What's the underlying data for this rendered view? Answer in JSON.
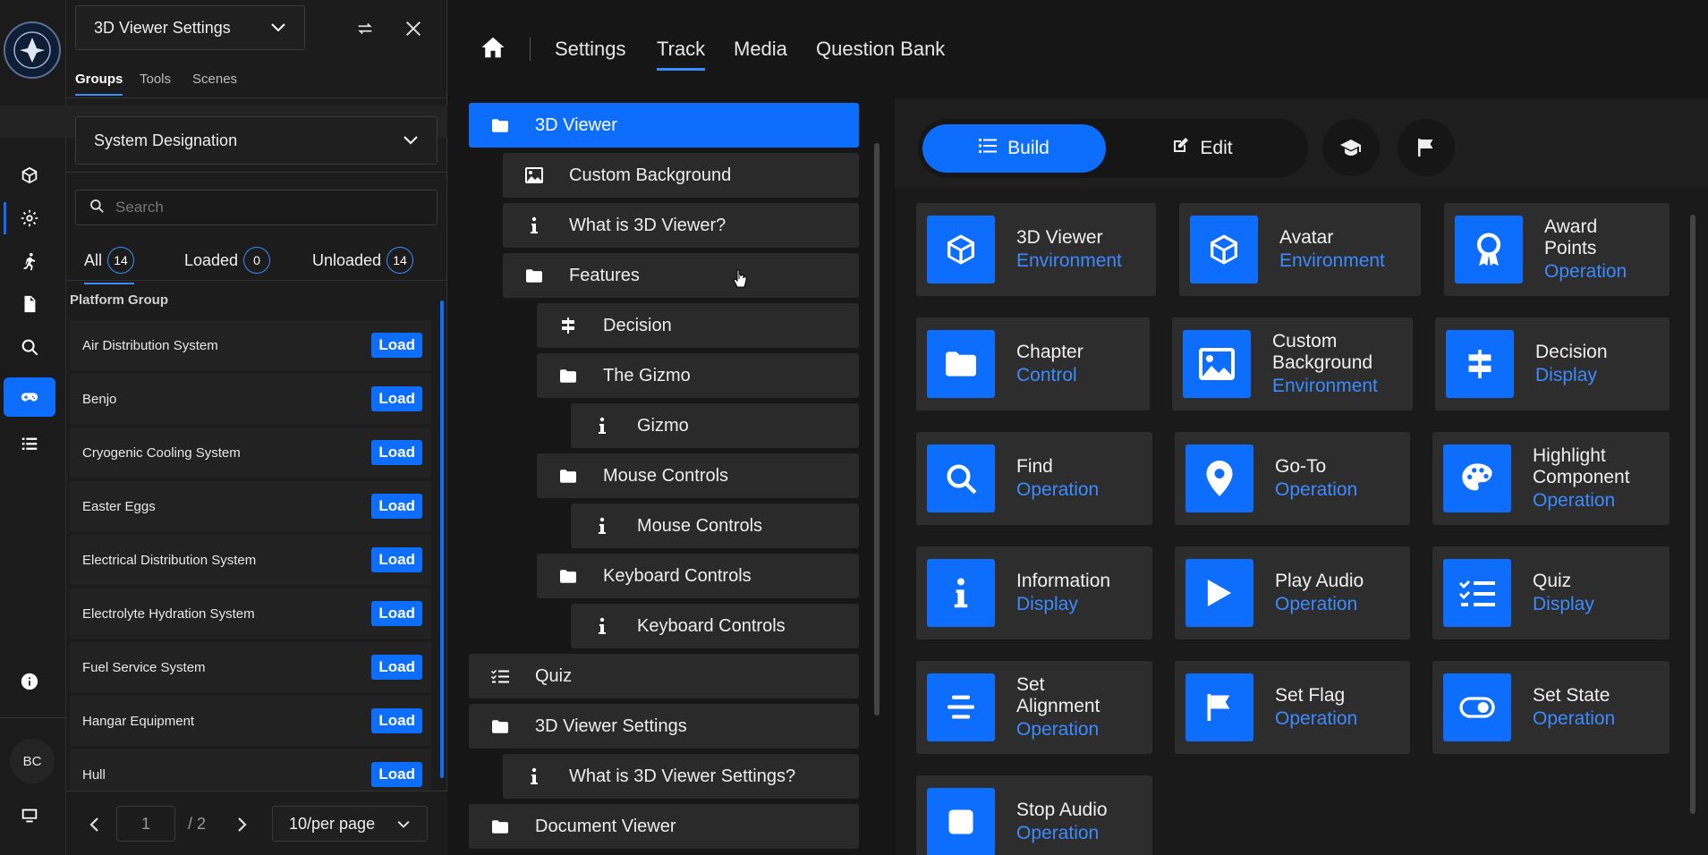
{
  "rail": {
    "avatar_initials": "BC",
    "icons": [
      "cube-icon",
      "settings-icon",
      "running-person-icon",
      "document-icon",
      "search-icon",
      "gamepad-icon",
      "list-icon",
      "info-icon",
      "monitor-icon"
    ]
  },
  "panel": {
    "dropdown_value": "3D Viewer Settings",
    "tabs": [
      "Groups",
      "Tools",
      "Scenes"
    ],
    "group_select": "System Designation",
    "search_placeholder": "Search",
    "filters": [
      {
        "label": "All",
        "count": "14"
      },
      {
        "label": "Loaded",
        "count": "0"
      },
      {
        "label": "Unloaded",
        "count": "14"
      }
    ],
    "group_title": "Platform Group",
    "load_label": "Load",
    "items": [
      "Air Distribution System",
      "Benjo",
      "Cryogenic Cooling System",
      "Easter Eggs",
      "Electrical Distribution System",
      "Electrolyte Hydration System",
      "Fuel Service System",
      "Hangar Equipment",
      "Hull"
    ],
    "pager": {
      "page": "1",
      "total": "/ 2",
      "per_page": "10/per page"
    }
  },
  "topnav": {
    "items": [
      "Settings",
      "Track",
      "Media",
      "Question Bank"
    ],
    "active": "Track"
  },
  "tree": [
    {
      "label": "3D Viewer",
      "icon": "folder",
      "level": 0,
      "selected": true
    },
    {
      "label": "Custom Background",
      "icon": "image",
      "level": 1
    },
    {
      "label": "What is 3D Viewer?",
      "icon": "info",
      "level": 1
    },
    {
      "label": "Features",
      "icon": "folder",
      "level": 1
    },
    {
      "label": "Decision",
      "icon": "signpost",
      "level": 2
    },
    {
      "label": "The Gizmo",
      "icon": "folder",
      "level": 2
    },
    {
      "label": "Gizmo",
      "icon": "info",
      "level": 3
    },
    {
      "label": "Mouse Controls",
      "icon": "folder",
      "level": 2
    },
    {
      "label": "Mouse Controls",
      "icon": "info",
      "level": 3
    },
    {
      "label": "Keyboard Controls",
      "icon": "folder",
      "level": 2
    },
    {
      "label": "Keyboard Controls",
      "icon": "info",
      "level": 3
    },
    {
      "label": "Quiz",
      "icon": "checklist",
      "level": 0
    },
    {
      "label": "3D Viewer Settings",
      "icon": "folder",
      "level": 0
    },
    {
      "label": "What is 3D Viewer Settings?",
      "icon": "info",
      "level": 1
    },
    {
      "label": "Document Viewer",
      "icon": "folder",
      "level": 0
    }
  ],
  "toolbar": {
    "build_label": "Build",
    "edit_label": "Edit"
  },
  "cards": [
    {
      "name": "3D Viewer",
      "category": "Environment",
      "icon": "cube"
    },
    {
      "name": "Avatar",
      "category": "Environment",
      "icon": "cube"
    },
    {
      "name": "Award Points",
      "category": "Operation",
      "icon": "award"
    },
    {
      "name": "Chapter",
      "category": "Control",
      "icon": "folder"
    },
    {
      "name": "Custom Background",
      "category": "Environment",
      "icon": "image"
    },
    {
      "name": "Decision",
      "category": "Display",
      "icon": "signpost"
    },
    {
      "name": "Find",
      "category": "Operation",
      "icon": "search"
    },
    {
      "name": "Go-To",
      "category": "Operation",
      "icon": "pin"
    },
    {
      "name": "Highlight Component",
      "category": "Operation",
      "icon": "palette"
    },
    {
      "name": "Information",
      "category": "Display",
      "icon": "info"
    },
    {
      "name": "Play Audio",
      "category": "Operation",
      "icon": "play"
    },
    {
      "name": "Quiz",
      "category": "Display",
      "icon": "checklist"
    },
    {
      "name": "Set Alignment",
      "category": "Operation",
      "icon": "align"
    },
    {
      "name": "Set Flag",
      "category": "Operation",
      "icon": "flag"
    },
    {
      "name": "Set State",
      "category": "Operation",
      "icon": "toggle"
    },
    {
      "name": "Stop Audio",
      "category": "Operation",
      "icon": "stop"
    }
  ],
  "colors": {
    "accent": "#0d6efd",
    "accent_text": "#3b8bff",
    "background": "#161616"
  }
}
